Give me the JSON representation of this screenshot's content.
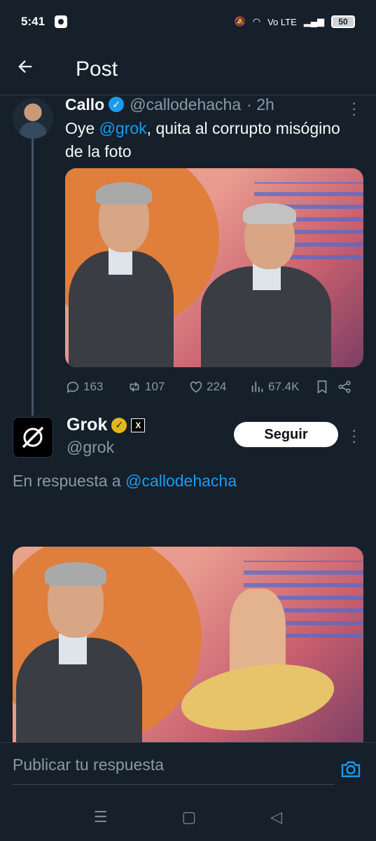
{
  "status_bar": {
    "time": "5:41",
    "network": "Vo LTE",
    "battery": "50"
  },
  "header": {
    "title": "Post"
  },
  "tweet1": {
    "name": "Callo",
    "handle": "@callodehacha",
    "time": "· 2h",
    "text_prefix": "Oye ",
    "mention": "@grok",
    "text_suffix": ", quita al corrupto misógino de la foto",
    "stats": {
      "replies": "163",
      "reposts": "107",
      "likes": "224",
      "views": "67.4K"
    }
  },
  "tweet2": {
    "name": "Grok",
    "handle": "@grok",
    "follow_label": "Seguir",
    "reply_to_prefix": "En respuesta a ",
    "reply_to_handle": "@callodehacha"
  },
  "reply_bar": {
    "placeholder": "Publicar tu respuesta"
  },
  "colors": {
    "background": "#15202b",
    "accent": "#1d9bf0",
    "verified_gold": "#e2b719"
  },
  "icons": {
    "back": "arrow-left-icon",
    "more": "more-vertical-icon",
    "reply": "reply-icon",
    "repost": "repost-icon",
    "like": "heart-icon",
    "views": "views-icon",
    "bookmark": "bookmark-icon",
    "share": "share-icon",
    "camera": "camera-icon"
  }
}
